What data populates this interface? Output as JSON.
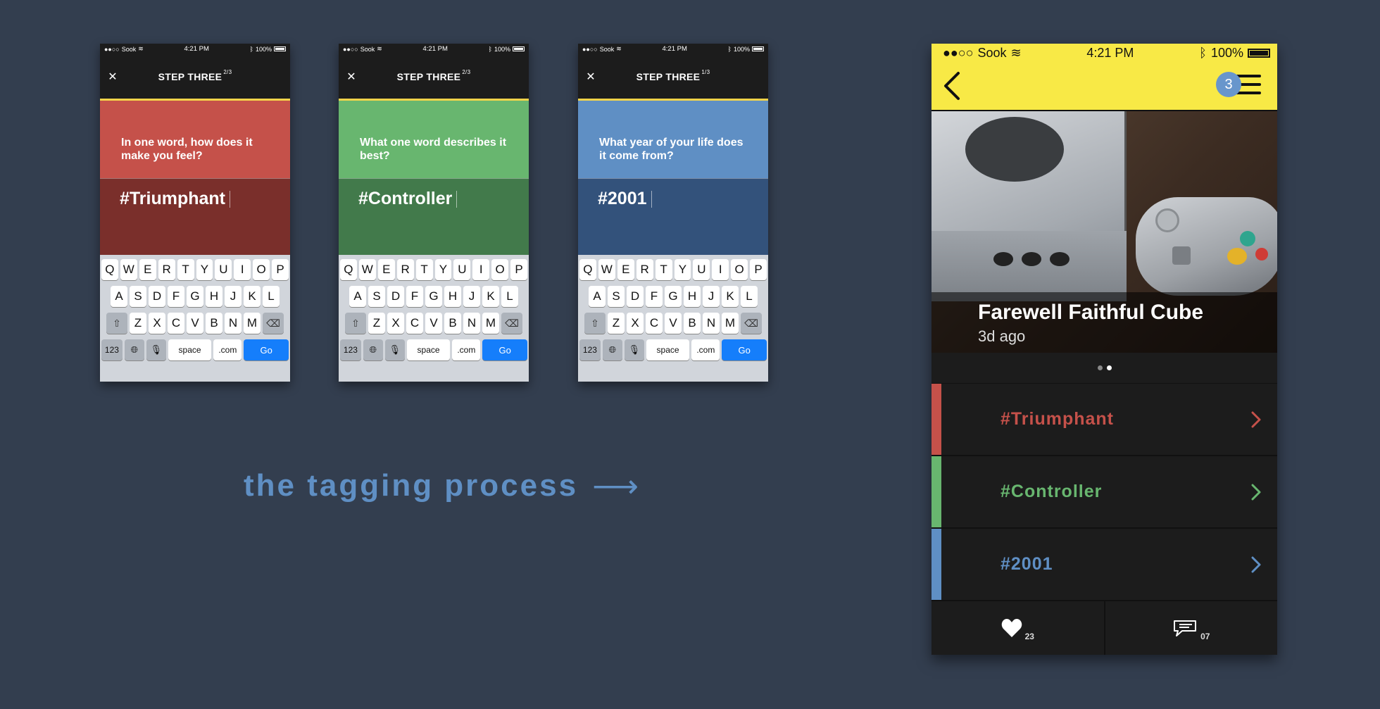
{
  "status_bar": {
    "carrier": "Sook",
    "signal": "●●○○",
    "time": "4:21 PM",
    "battery": "100%"
  },
  "steps": [
    {
      "label": "STEP THREE",
      "fraction": "2/3",
      "question": "In one word, how does it make you feel?",
      "answer": "#Triumphant",
      "theme": "red"
    },
    {
      "label": "STEP THREE",
      "fraction": "2/3",
      "question": "What one word describes it best?",
      "answer": "#Controller",
      "theme": "green"
    },
    {
      "label": "STEP THREE",
      "fraction": "1/3",
      "question": "What year of your life does it come from?",
      "answer": "#2001",
      "theme": "blue"
    }
  ],
  "keyboard": {
    "row1": [
      "Q",
      "W",
      "E",
      "R",
      "T",
      "Y",
      "U",
      "I",
      "O",
      "P"
    ],
    "row2": [
      "A",
      "S",
      "D",
      "F",
      "G",
      "H",
      "J",
      "K",
      "L"
    ],
    "row3": [
      "Z",
      "X",
      "C",
      "V",
      "B",
      "N",
      "M"
    ],
    "num_key": "123",
    "space_key": "space",
    "com_key": ".com",
    "go_key": "Go"
  },
  "caption": {
    "text": "the tagging process",
    "arrow": "⟶"
  },
  "detail": {
    "status_bar": {
      "carrier": "Sook",
      "signal": "●●○○",
      "time": "4:21 PM",
      "battery": "100%"
    },
    "badge_count": "3",
    "post_title": "Farewell Faithful Cube",
    "post_age": "3d ago",
    "tags": [
      {
        "text": "#Triumphant",
        "color": "#c5514a"
      },
      {
        "text": "#Controller",
        "color": "#68b66f"
      },
      {
        "text": "#2001",
        "color": "#5f8fc4"
      }
    ],
    "likes": "23",
    "comments": "07"
  },
  "colors": {
    "background": "#333e4f",
    "header_yellow": "#f8e946",
    "accent_blue": "#157efb"
  }
}
